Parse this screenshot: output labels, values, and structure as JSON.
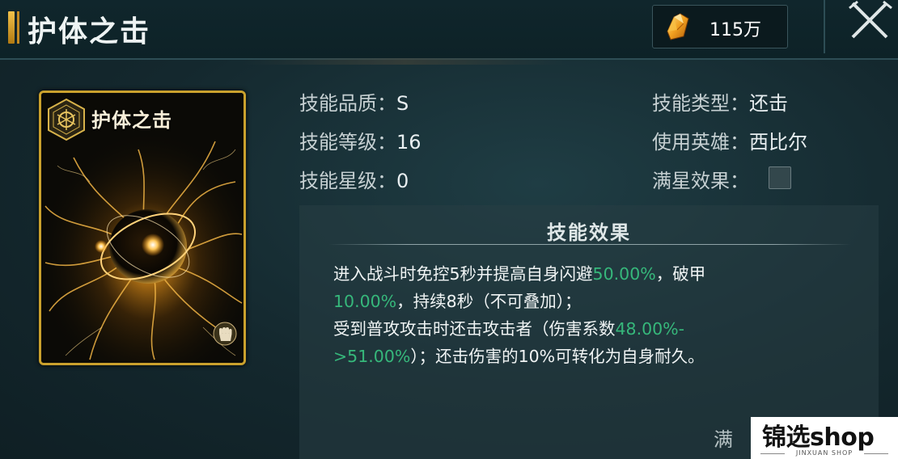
{
  "header": {
    "title": "护体之击",
    "currency": {
      "icon": "gold-crystal-icon",
      "value": "115万"
    },
    "close_icon": "close-crossed-swords-icon"
  },
  "card": {
    "title": "护体之击",
    "badge_icon": "hexagon-rune-icon",
    "type_icon": "fist-icon",
    "art": "golden-energy-orb"
  },
  "stats": {
    "quality": {
      "label": "技能品质：",
      "value": "S"
    },
    "level": {
      "label": "技能等级：",
      "value": "16"
    },
    "stars": {
      "label": "技能星级：",
      "value": "0"
    },
    "type": {
      "label": "技能类型：",
      "value": "还击"
    },
    "hero": {
      "label": "使用英雄：",
      "value": "西比尔"
    },
    "full_star": {
      "label": "满星效果："
    }
  },
  "effect": {
    "title": "技能效果",
    "line1_a": "进入战斗时免控5秒并提高自身闪避",
    "line1_hl": "50.00%",
    "line1_b": "，破甲",
    "line2_hl": "10.00%",
    "line2_b": "，持续8秒（不可叠加）；",
    "line3_a": "受到普攻攻击时还击攻击者（伤害系数",
    "line3_hl": "48.00%-",
    "line4_hl": ">51.00%",
    "line4_b": "）；还击伤害的10%可转化为自身耐久。",
    "more_label": "满"
  },
  "watermark": {
    "text": "锦选shop",
    "sub": "JINXUAN SHOP"
  },
  "colors": {
    "highlight": "#36b87b",
    "gold": "#caa12d",
    "background": "#14282e"
  }
}
